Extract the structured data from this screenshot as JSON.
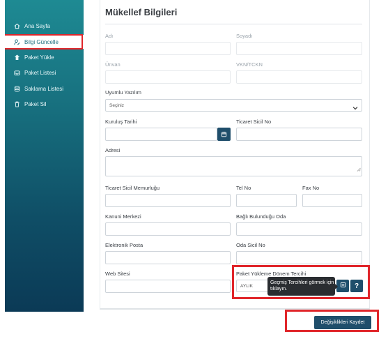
{
  "sidebar": {
    "items": [
      {
        "label": "Ana Sayfa",
        "icon": "home-icon"
      },
      {
        "label": "Bilgi Güncelle",
        "icon": "user-edit-icon",
        "active": true
      },
      {
        "label": "Paket Yükle",
        "icon": "upload-icon"
      },
      {
        "label": "Paket Listesi",
        "icon": "inbox-icon"
      },
      {
        "label": "Saklama Listesi",
        "icon": "database-icon"
      },
      {
        "label": "Paket Sil",
        "icon": "trash-icon"
      }
    ]
  },
  "form": {
    "title": "Mükellef Bilgileri",
    "ad_label": "Adı",
    "soyad_label": "Soyadı",
    "unvan_label": "Ünvan",
    "vkn_label": "VKN/TCKN",
    "uyumlu_label": "Uyumlu Yazılım",
    "uyumlu_value": "Seçiniz",
    "kurulus_label": "Kuruluş Tarihi",
    "ticaret_sicil_label": "Ticaret Sicil No",
    "adres_label": "Adresi",
    "memurlugu_label": "Ticaret Sicil Memurluğu",
    "tel_label": "Tel No",
    "fax_label": "Fax No",
    "kanuni_label": "Kanuni Merkezi",
    "oda_label": "Bağlı Bulunduğu Oda",
    "eposta_label": "Elektronik Posta",
    "oda_sicil_label": "Oda Sicil No",
    "web_label": "Web Sitesi",
    "period_label": "Paket Yükleme Dönem Tercihi",
    "period_value": "AYLIK",
    "tooltip": "Geçmiş Tercihleri görmek için tıklayın.",
    "help_label": "?",
    "save_label": "Değişiklikleri Kaydet"
  },
  "colors": {
    "accent": "#1f4e6b",
    "sidebar_top": "#1e8a93",
    "sidebar_bottom": "#0b3a56",
    "highlight": "#e0262b"
  }
}
